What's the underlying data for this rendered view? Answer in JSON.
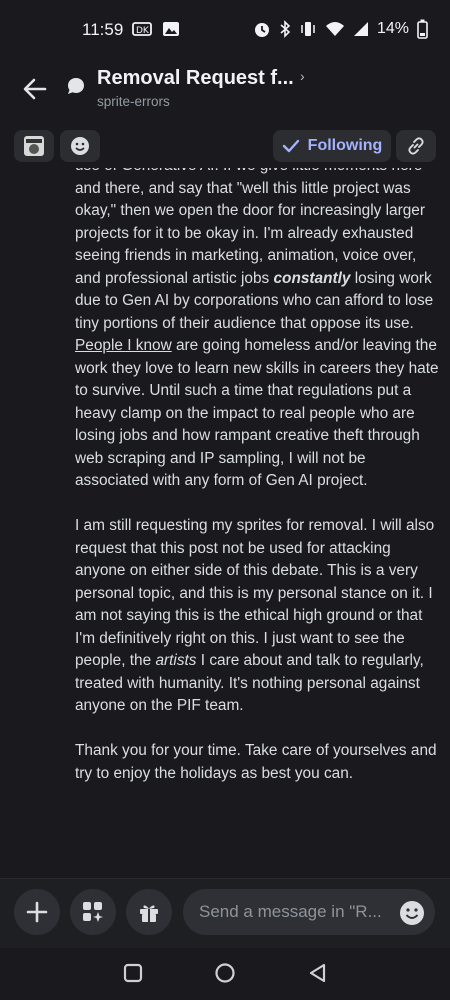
{
  "status_bar": {
    "time": "11:59",
    "battery": "14%"
  },
  "header": {
    "title": "Removal Request f...",
    "subtitle": "sprite-errors"
  },
  "toolbar": {
    "following_label": "Following"
  },
  "message": {
    "paragraph1": {
      "text_a": "use of Generative AI. If we give little moments here and there, and say that \"well this little project was okay,\" then we open the door for increasingly larger projects for it to be okay in. I'm already exhausted seeing friends in marketing, animation, voice over, and professional artistic jobs ",
      "emphasis": "constantly",
      "text_b": " losing work due to Gen AI by corporations who can afford to lose tiny portions of their audience that oppose its use. ",
      "link": "People I know",
      "text_c": " are going homeless and/or leaving the work they love to learn new skills in careers they hate to survive. Until such a time that regulations put a heavy clamp on the impact to real people who are losing jobs and how rampant creative theft through web scraping and IP sampling, I will not be associated with any form of Gen AI project."
    },
    "paragraph2": {
      "text_a": "I am still requesting my sprites for removal. I will also request that this post not be used for attacking anyone on either side of this debate. This is a very personal topic, and this is my personal stance on it. I am not saying this is the ethical high ground or that I'm definitively right on this. I just want to see the people, the ",
      "emphasis": "artists",
      "text_b": " I care about and talk to regularly, treated with humanity. It's nothing personal against anyone on the PIF team."
    },
    "paragraph3": "Thank you for your time. Take care of yourselves and try to enjoy the holidays as best you can."
  },
  "composer": {
    "placeholder": "Send a message in \"R..."
  },
  "colors": {
    "background": "#1a1a1e",
    "accent": "#a5b3ff",
    "button": "#2b2d31"
  }
}
